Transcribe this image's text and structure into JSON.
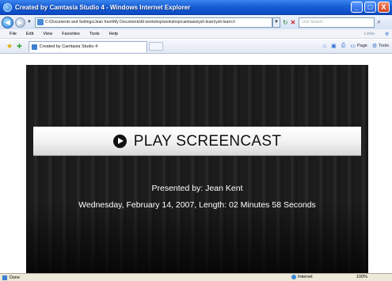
{
  "window": {
    "title": "Created by Camtasia Studio 4 - Windows Internet Explorer",
    "buttons": {
      "minimize": "_",
      "maximize": "□",
      "close": "X"
    }
  },
  "address_bar": {
    "url": "C:\\Documents and Settings\\Jean Kent\\My Documents\\fd workshop\\workshop\\camtasia\\ysh-learn\\ysh-learn.h",
    "search_placeholder": "Live Search"
  },
  "menu": {
    "items": [
      "File",
      "Edit",
      "View",
      "Favorites",
      "Tools",
      "Help"
    ],
    "links_label": "Links"
  },
  "command_bar": {
    "tab_label": "Created by Camtasia Studio 4",
    "page_label": "Page",
    "tools_label": "Tools"
  },
  "player": {
    "play_label": "PLAY SCREENCAST",
    "presenter": "Presented by: Jean Kent",
    "info": "Wednesday, February 14, 2007, Length: 02 Minutes 58 Seconds"
  },
  "status_bar": {
    "status": "Done",
    "zone": "Internet",
    "zoom": "100%"
  }
}
